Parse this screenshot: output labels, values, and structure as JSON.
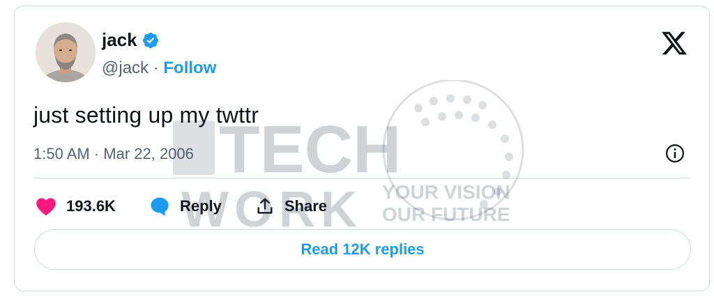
{
  "tweet": {
    "author_name": "jack",
    "handle": "@jack",
    "separator": "·",
    "follow_label": "Follow",
    "text": "just setting up my twttr",
    "timestamp": "1:50 AM · Mar 22, 2006",
    "likes": "193.6K",
    "reply_label": "Reply",
    "share_label": "Share",
    "read_replies_label": "Read 12K replies"
  },
  "watermark": {
    "line1": "TECH",
    "line2": "WORK",
    "tagline1": "YOUR VISION",
    "tagline2": "OUR FUTURE"
  },
  "icons": {
    "verified": "verified-badge-icon",
    "brand": "x-logo-icon",
    "info": "info-icon",
    "like": "heart-icon",
    "reply": "reply-bubble-icon",
    "share": "share-upload-icon"
  },
  "colors": {
    "accent": "#1d9bf0",
    "like": "#f91880",
    "text": "#0f1419",
    "muted": "#536471",
    "border": "#cfd9de"
  }
}
